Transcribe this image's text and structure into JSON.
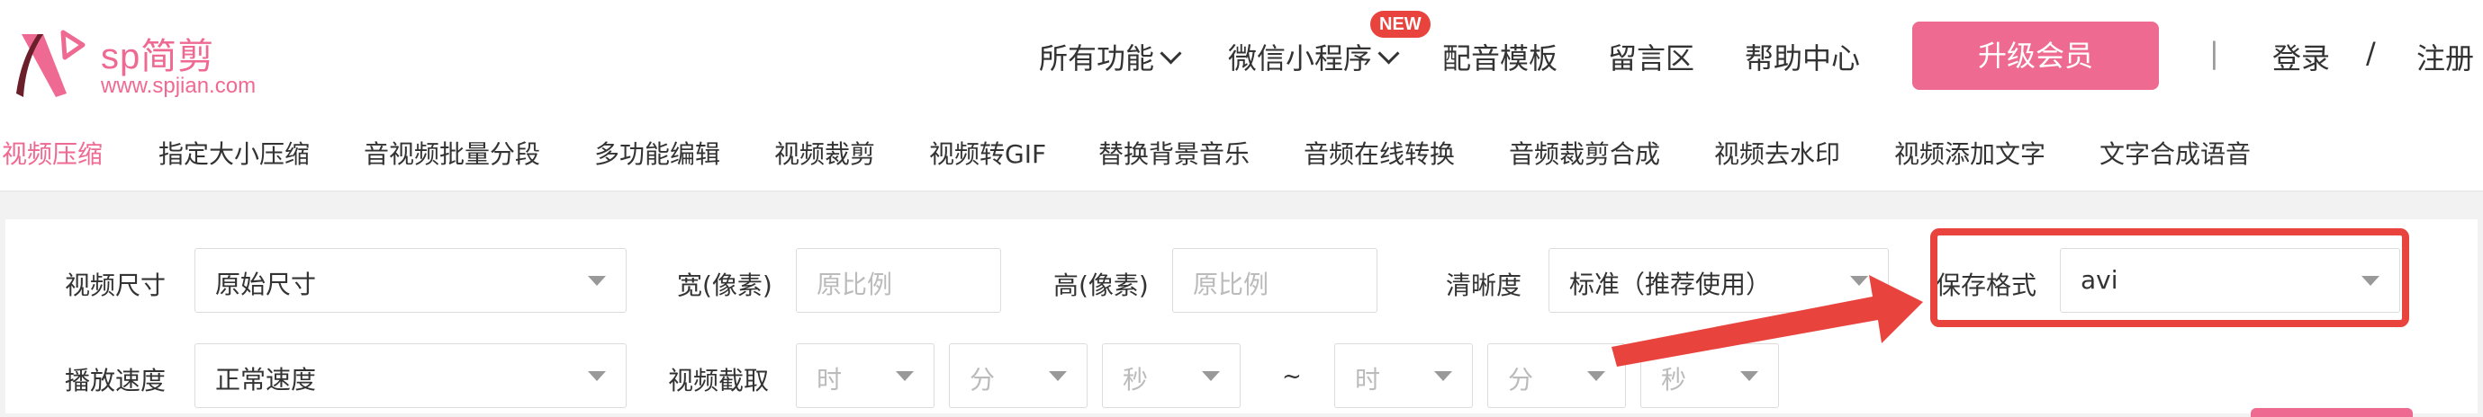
{
  "brand": {
    "name": "sp简剪",
    "url": "www.spjian.com",
    "accent": "#ee6a91"
  },
  "topnav": {
    "all_features": "所有功能",
    "mini_program": "微信小程序",
    "new_badge": "NEW",
    "dubbing_templates": "配音模板",
    "message_board": "留言区",
    "help_center": "帮助中心",
    "upgrade": "升级会员",
    "divider": "|",
    "login": "登录",
    "slash": "/",
    "register": "注册"
  },
  "subnav": [
    "视频压缩",
    "指定大小压缩",
    "音视频批量分段",
    "多功能编辑",
    "视频裁剪",
    "视频转GIF",
    "替换背景音乐",
    "音频在线转换",
    "音频裁剪合成",
    "视频去水印",
    "视频添加文字",
    "文字合成语音"
  ],
  "form": {
    "video_size": {
      "label": "视频尺寸",
      "value": "原始尺寸"
    },
    "width": {
      "label": "宽(像素)",
      "placeholder": "原比例"
    },
    "height": {
      "label": "高(像素)",
      "placeholder": "原比例"
    },
    "clarity": {
      "label": "清晰度",
      "value": "标准（推荐使用）"
    },
    "save_format": {
      "label": "保存格式",
      "value": "avi"
    },
    "speed": {
      "label": "播放速度",
      "value": "正常速度"
    },
    "clip": {
      "label": "视频截取",
      "hour": "时",
      "minute": "分",
      "second": "秒",
      "tilde": "~"
    }
  },
  "annotation_color": "#e8433c"
}
